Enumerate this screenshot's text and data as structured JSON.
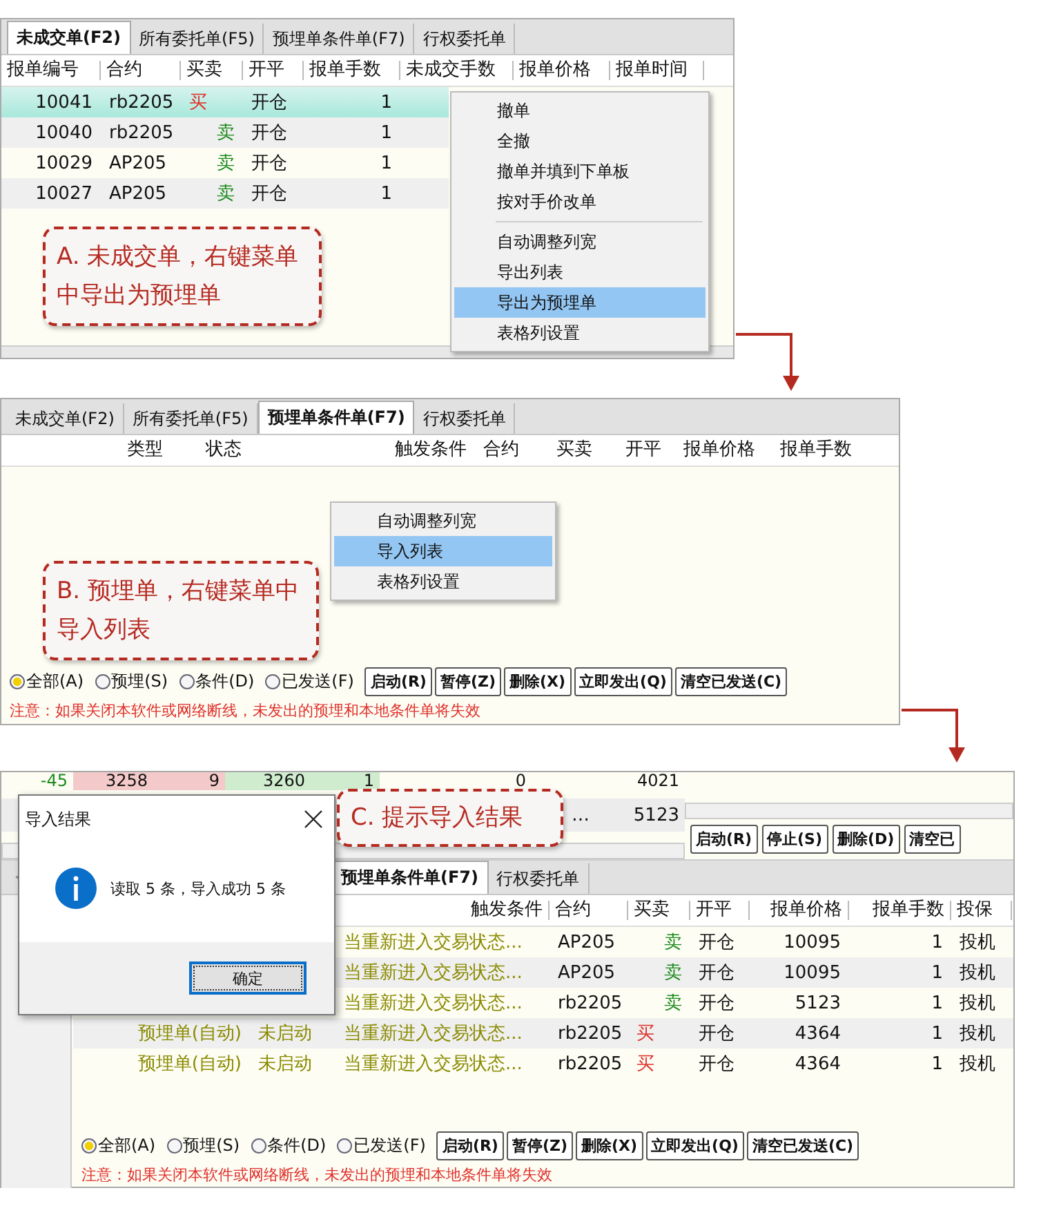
{
  "panel_a": {
    "tabs": [
      {
        "label": "未成交单(F2)",
        "selected": true
      },
      {
        "label": "所有委托单(F5)",
        "selected": false
      },
      {
        "label": "预埋单条件单(F7)",
        "selected": false
      },
      {
        "label": "行权委托单",
        "selected": false
      }
    ],
    "columns": [
      "报单编号",
      "合约",
      "买卖",
      "开平",
      "报单手数",
      "未成交手数",
      "报单价格",
      "报单时间"
    ],
    "rows": [
      {
        "id": "10041",
        "contract": "rb2205",
        "side": "买",
        "kind": "buy",
        "offset": "开仓",
        "qty": "1",
        "selected": true
      },
      {
        "id": "10040",
        "contract": "rb2205",
        "side": "卖",
        "kind": "sell",
        "offset": "开仓",
        "qty": "1",
        "selected": false
      },
      {
        "id": "10029",
        "contract": "AP205",
        "side": "卖",
        "kind": "sell",
        "offset": "开仓",
        "qty": "1",
        "selected": false
      },
      {
        "id": "10027",
        "contract": "AP205",
        "side": "卖",
        "kind": "sell",
        "offset": "开仓",
        "qty": "1",
        "selected": false
      }
    ],
    "context_menu": [
      [
        {
          "label": "撤单",
          "selected": false
        },
        {
          "label": "全撤",
          "selected": false
        },
        {
          "label": "撤单并填到下单板",
          "selected": false
        },
        {
          "label": "按对手价改单",
          "selected": false
        }
      ],
      [
        {
          "label": "自动调整列宽",
          "selected": false
        },
        {
          "label": "导出列表",
          "selected": false
        },
        {
          "label": "导出为预埋单",
          "selected": true
        },
        {
          "label": "表格列设置",
          "selected": false
        }
      ]
    ],
    "callout": "A. 未成交单，右键菜单中导出为预埋单"
  },
  "panel_b": {
    "tabs": [
      {
        "label": "未成交单(F2)",
        "selected": false
      },
      {
        "label": "所有委托单(F5)",
        "selected": false
      },
      {
        "label": "预埋单条件单(F7)",
        "selected": true
      },
      {
        "label": "行权委托单",
        "selected": false
      }
    ],
    "columns": [
      "类型",
      "状态",
      "触发条件",
      "合约",
      "买卖",
      "开平",
      "报单价格",
      "报单手数"
    ],
    "context_menu": [
      {
        "label": "自动调整列宽",
        "selected": false
      },
      {
        "label": "导入列表",
        "selected": true
      },
      {
        "label": "表格列设置",
        "selected": false
      }
    ],
    "callout": "B. 预埋单，右键菜单中导入列表",
    "filters": [
      {
        "label": "全部(A)",
        "selected": true
      },
      {
        "label": "预埋(S)",
        "selected": false
      },
      {
        "label": "条件(D)",
        "selected": false
      },
      {
        "label": "已发送(F)",
        "selected": false
      }
    ],
    "buttons": [
      "启动(R)",
      "暂停(Z)",
      "删除(X)",
      "立即发出(Q)",
      "清空已发送(C)"
    ],
    "note": "注意：如果关闭本软件或网络断线，未发出的预埋和本地条件单将失效"
  },
  "panel_c": {
    "background_rows": [
      [
        "-45",
        "3258",
        "9",
        "3260",
        "1",
        "0",
        "4021"
      ],
      [
        "",
        "",
        "",
        "",
        "",
        "…",
        "5123"
      ]
    ],
    "top_buttons": [
      "启动(R)",
      "停止(S)",
      "删除(D)",
      "清空已"
    ],
    "tabs": [
      {
        "label": "预埋单条件单(F7)",
        "selected": true
      },
      {
        "label": "行权委托单",
        "selected": false
      }
    ],
    "columns": [
      "触发条件",
      "合约",
      "买卖",
      "开平",
      "报单价格",
      "报单手数",
      "投保"
    ],
    "rows": [
      {
        "trigger": "当重新进入交易状态...",
        "contract": "AP205",
        "side": "卖",
        "kind": "sell",
        "offset": "开仓",
        "price": "10095",
        "qty": "1",
        "hedge": "投机"
      },
      {
        "trigger": "当重新进入交易状态...",
        "contract": "AP205",
        "side": "卖",
        "kind": "sell",
        "offset": "开仓",
        "price": "10095",
        "qty": "1",
        "hedge": "投机"
      },
      {
        "trigger": "当重新进入交易状态...",
        "contract": "rb2205",
        "side": "卖",
        "kind": "sell",
        "offset": "开仓",
        "price": "5123",
        "qty": "1",
        "hedge": "投机"
      },
      {
        "type": "预埋单(自动)",
        "status": "未启动",
        "trigger": "当重新进入交易状态...",
        "contract": "rb2205",
        "side": "买",
        "kind": "buy",
        "offset": "开仓",
        "price": "4364",
        "qty": "1",
        "hedge": "投机"
      },
      {
        "type": "预埋单(自动)",
        "status": "未启动",
        "trigger": "当重新进入交易状态...",
        "contract": "rb2205",
        "side": "买",
        "kind": "buy",
        "offset": "开仓",
        "price": "4364",
        "qty": "1",
        "hedge": "投机"
      }
    ],
    "filters": [
      {
        "label": "全部(A)",
        "selected": true
      },
      {
        "label": "预埋(S)",
        "selected": false
      },
      {
        "label": "条件(D)",
        "selected": false
      },
      {
        "label": "已发送(F)",
        "selected": false
      }
    ],
    "buttons": [
      "启动(R)",
      "暂停(Z)",
      "删除(X)",
      "立即发出(Q)",
      "清空已发送(C)"
    ],
    "note": "注意：如果关闭本软件或网络断线，未发出的预埋和本地条件单将失效",
    "dialog": {
      "title": "导入结果",
      "message": "读取 5 条，导入成功 5 条",
      "button": "确定"
    },
    "callout": "C. 提示导入结果"
  }
}
